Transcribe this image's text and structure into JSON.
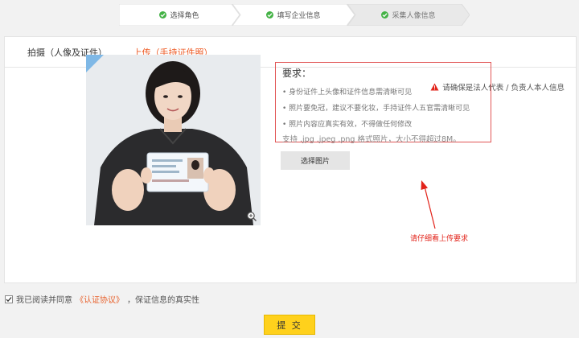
{
  "stepper": {
    "steps": [
      {
        "label": "选择角色",
        "state": "done"
      },
      {
        "label": "填写企业信息",
        "state": "done"
      },
      {
        "label": "采集人像信息",
        "state": "current"
      }
    ],
    "colors": {
      "done_bg": "#ffffff",
      "current_bg": "#e9e9e9",
      "check": "#43b245"
    }
  },
  "tabs": [
    {
      "label": "拍摄（人像及证件）",
      "active": false
    },
    {
      "label": "上传（手持证件照）",
      "active": true
    }
  ],
  "notice": {
    "icon": "warning-icon",
    "text": "请确保是法人代表 / 负责人本人信息"
  },
  "photo": {
    "alt": "手持身份证示例照片",
    "zoom_icon": "zoom-in-icon"
  },
  "requirements": {
    "title": "要求：",
    "items": [
      "• 身份证件上头像和证件信息需清晰可见",
      "• 照片要免冠，建议不要化妆，手持证件人五官需清晰可见",
      "• 照片内容应真实有效，不得做任何修改"
    ],
    "support": "支持 .jpg .jpeg .png 格式照片，大小不得超过8M。"
  },
  "choose_button": "选择图片",
  "annotation": "请仔细看上传要求",
  "agreement": {
    "checked": true,
    "prefix": "我已阅读并同意",
    "link": "《认证协议》",
    "suffix": "，保证信息的真实性"
  },
  "submit_label": "提 交",
  "accent": "#ee5a24",
  "submit_color": "#ffd11c"
}
